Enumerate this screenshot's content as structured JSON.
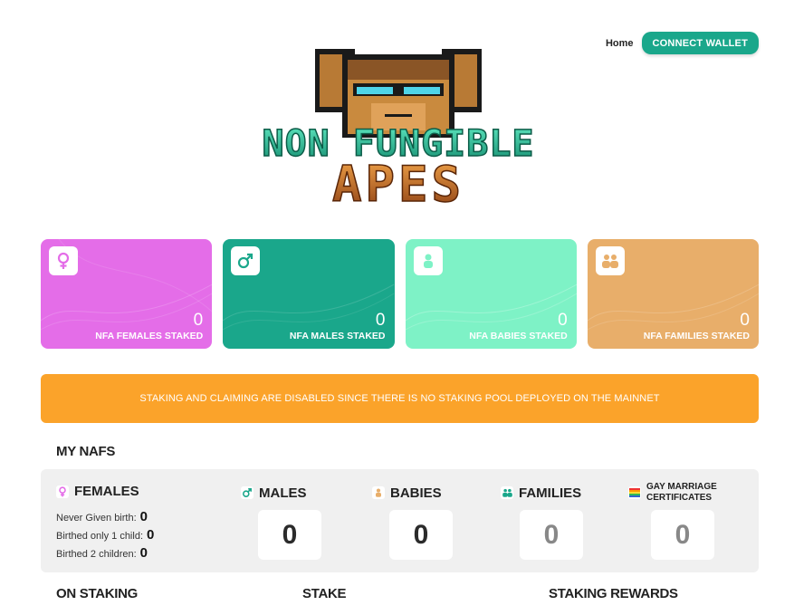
{
  "nav": {
    "home_label": "Home",
    "connect_label": "CONNECT WALLET"
  },
  "logo": {
    "line1": "NON FUNGIBLE",
    "line2": "APES"
  },
  "cards": [
    {
      "count": "0",
      "label": "NFA FEMALES STAKED",
      "color": "#e46de8",
      "icon": "female-icon"
    },
    {
      "count": "0",
      "label": "NFA MALES STAKED",
      "color": "#1aa78b",
      "icon": "male-icon"
    },
    {
      "count": "0",
      "label": "NFA BABIES STAKED",
      "color": "#7ef2c6",
      "icon": "baby-icon"
    },
    {
      "count": "0",
      "label": "NFA FAMILIES STAKED",
      "color": "#e8ae6a",
      "icon": "family-icon"
    }
  ],
  "alert": {
    "text": "STAKING AND CLAIMING ARE DISABLED SINCE THERE IS NO STAKING POOL DEPLOYED ON THE MAINNET"
  },
  "my_nafs": {
    "title": "MY NAFS",
    "females": {
      "title": "FEMALES",
      "rows": [
        {
          "label": "Never Given birth:",
          "value": "0"
        },
        {
          "label": "Birthed only 1 child:",
          "value": "0"
        },
        {
          "label": "Birthed 2 children:",
          "value": "0"
        }
      ]
    },
    "males": {
      "title": "MALES",
      "value": "0"
    },
    "babies": {
      "title": "BABIES",
      "value": "0"
    },
    "families": {
      "title": "FAMILIES",
      "value": "0"
    },
    "certificates": {
      "title_line1": "GAY MARRIAGE",
      "title_line2": "CERTIFICATES",
      "value": "0"
    }
  },
  "sections": {
    "on_staking": "ON STAKING",
    "stake": "STAKE",
    "rewards": "STAKING REWARDS"
  },
  "colors": {
    "accent": "#1aa78b",
    "alert": "#fba32a",
    "female": "#e46de8",
    "baby": "#7ef2c6",
    "family": "#e8ae6a"
  }
}
